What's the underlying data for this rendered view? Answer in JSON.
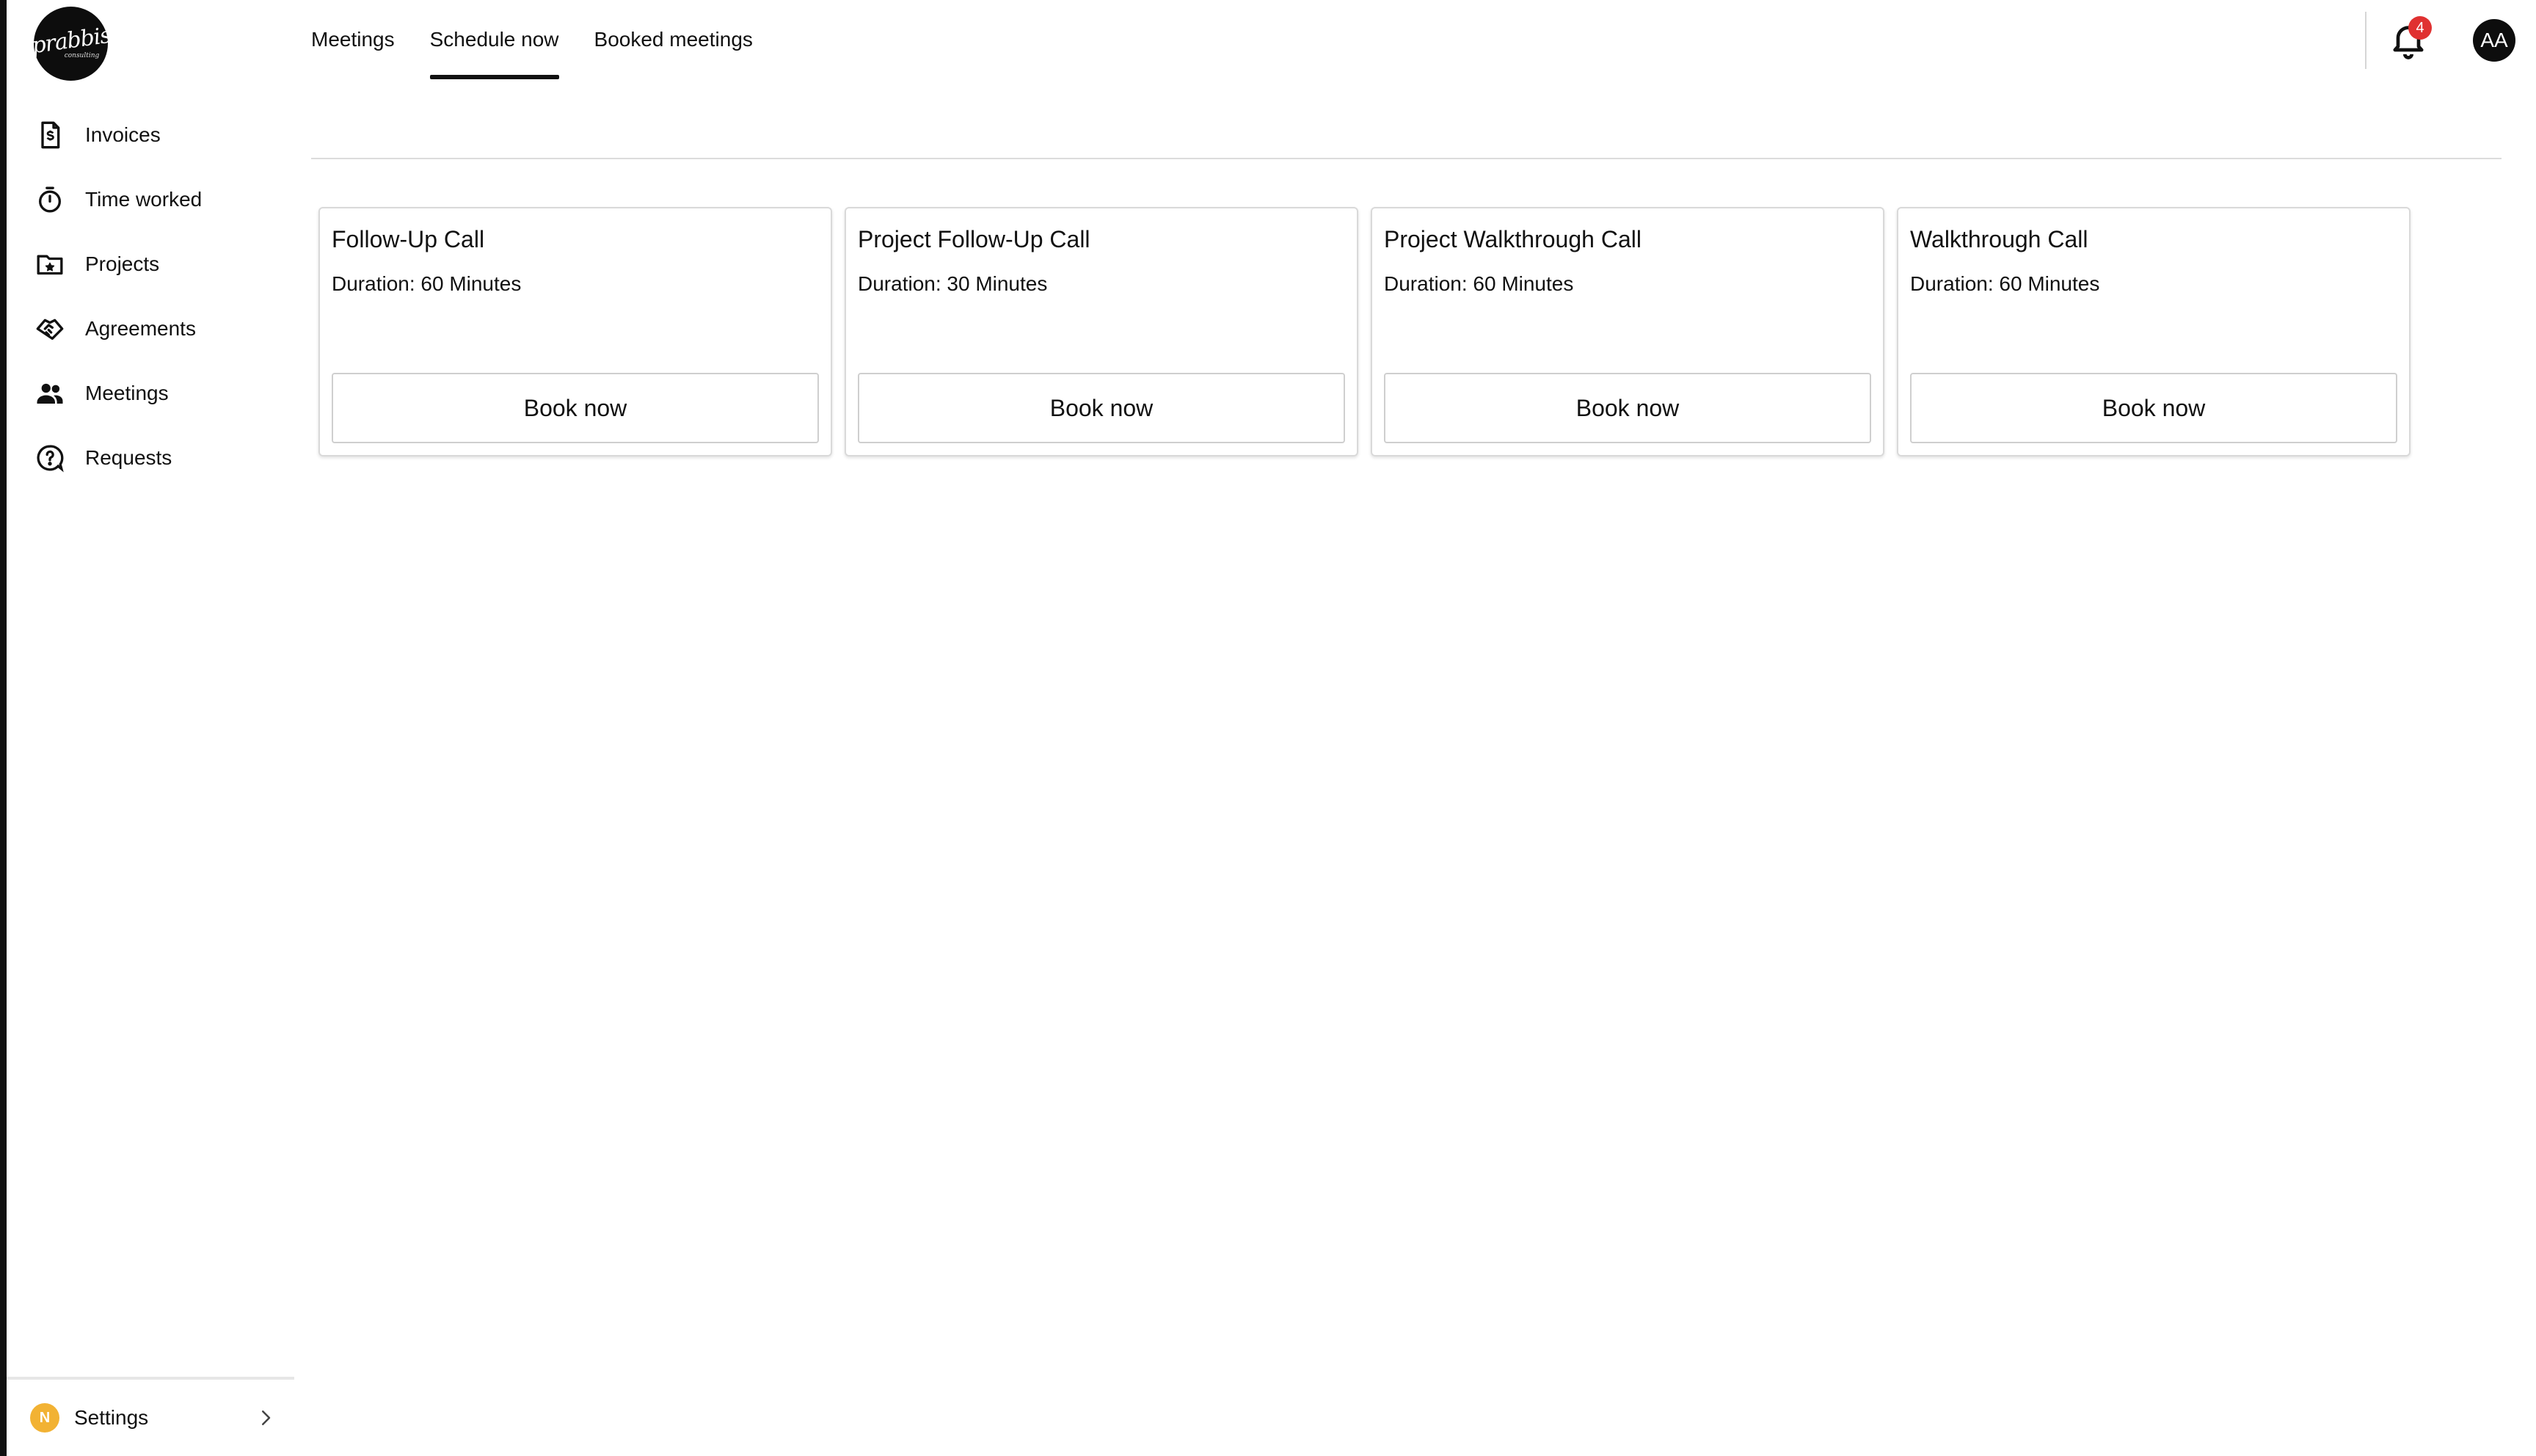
{
  "brand": {
    "logo_text": "prabbis",
    "logo_subtext": "consulting"
  },
  "sidebar": {
    "items": [
      {
        "label": "Invoices",
        "icon": "invoice-icon"
      },
      {
        "label": "Time worked",
        "icon": "stopwatch-icon"
      },
      {
        "label": "Projects",
        "icon": "folder-star-icon"
      },
      {
        "label": "Agreements",
        "icon": "handshake-icon"
      },
      {
        "label": "Meetings",
        "icon": "people-icon"
      },
      {
        "label": "Requests",
        "icon": "help-circle-icon"
      }
    ],
    "footer": {
      "badge": "N",
      "label": "Settings",
      "icon": "chevron-right-icon"
    }
  },
  "header": {
    "tabs": [
      {
        "label": "Meetings"
      },
      {
        "label": "Schedule now",
        "active": true
      },
      {
        "label": "Booked meetings"
      }
    ],
    "notifications": {
      "count": "4",
      "icon": "bell-icon"
    },
    "user": {
      "initials": "AA"
    }
  },
  "meeting_types": [
    {
      "title": "Follow-Up Call",
      "duration": "Duration: 60 Minutes",
      "button": "Book now"
    },
    {
      "title": "Project Follow-Up Call",
      "duration": "Duration: 30 Minutes",
      "button": "Book now"
    },
    {
      "title": "Project Walkthrough Call",
      "duration": "Duration: 60 Minutes",
      "button": "Book now"
    },
    {
      "title": "Walkthrough Call",
      "duration": "Duration: 60 Minutes",
      "button": "Book now"
    }
  ],
  "colors": {
    "accent": "#111111",
    "badge_red": "#e03131",
    "settings_badge": "#f2b233"
  }
}
